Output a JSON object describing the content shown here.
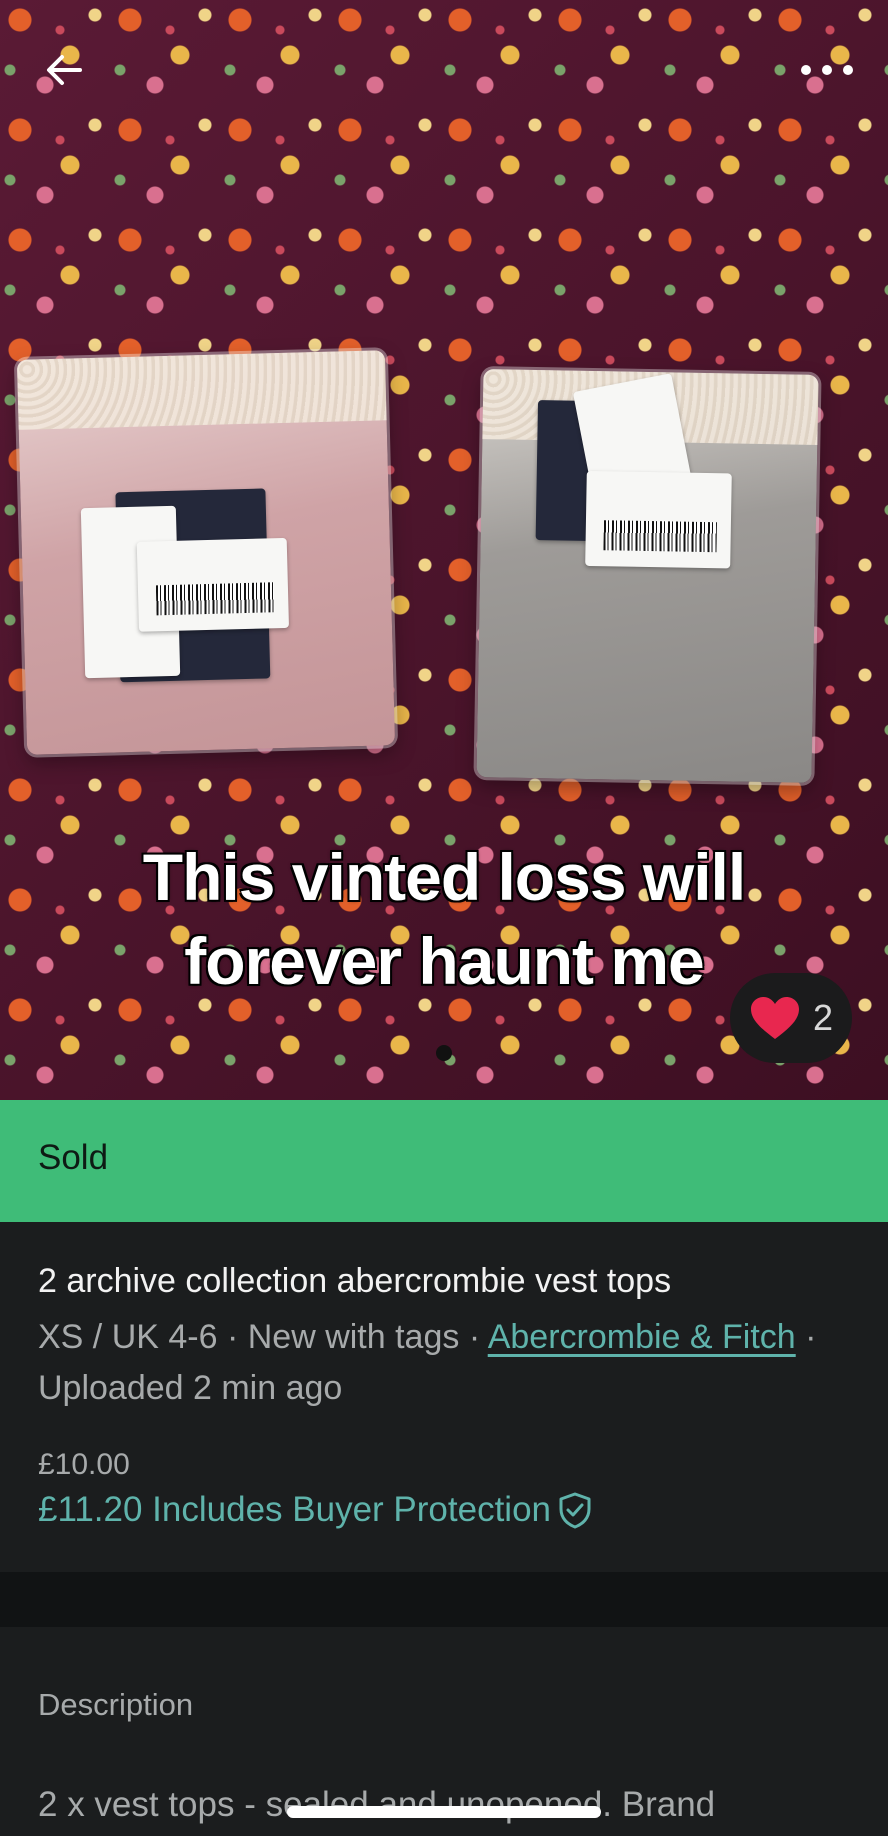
{
  "photo": {
    "caption_line1": "This vinted loss will",
    "caption_line2": "forever haunt me",
    "like_count": "2",
    "icons": {
      "back": "arrow-left-icon",
      "more": "more-horizontal-icon",
      "like": "heart-icon"
    },
    "carousel_page": 1
  },
  "status": {
    "label": "Sold",
    "color": "#3fbc78"
  },
  "listing": {
    "title": "2 archive collection abercrombie vest tops",
    "size": "XS / UK 4-6",
    "separator": " · ",
    "condition": "New with tags",
    "brand": "Abercrombie & Fitch",
    "uploaded": "Uploaded 2 min ago",
    "price": "£10.00",
    "price_with_protection": "£11.20 Includes Buyer Protection",
    "accent_color": "#5fb3ab"
  },
  "description": {
    "heading": "Description",
    "body": "2 x vest tops - sealed and unopened. Brand"
  }
}
